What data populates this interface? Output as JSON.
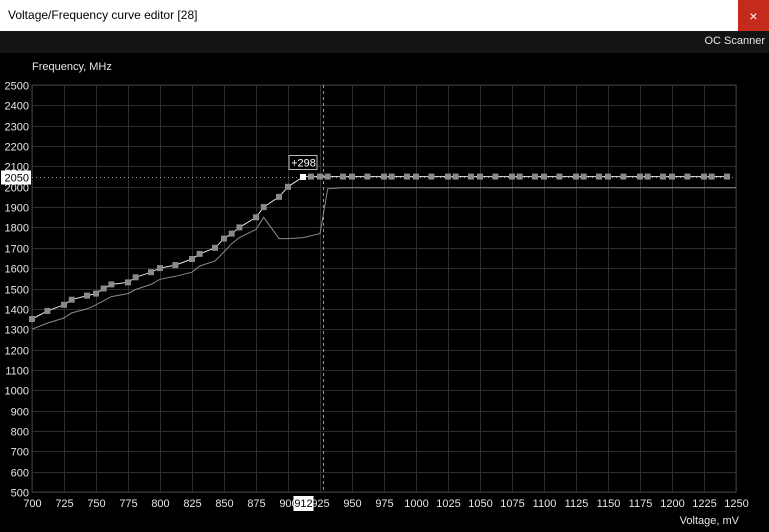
{
  "window": {
    "title": "Voltage/Frequency curve editor [28]",
    "close_label": "×"
  },
  "toolbar": {
    "oc_scanner_label": "OC Scanner"
  },
  "chart_data": {
    "type": "line",
    "ylabel": "Frequency, MHz",
    "xlabel": "Voltage, mV",
    "xlim": [
      700,
      1250
    ],
    "ylim": [
      500,
      2500
    ],
    "x_ticks": [
      700,
      725,
      750,
      775,
      800,
      825,
      850,
      875,
      900,
      925,
      950,
      975,
      1000,
      1025,
      1050,
      1075,
      1100,
      1125,
      1150,
      1175,
      1200,
      1225,
      1250
    ],
    "y_ticks": [
      500,
      600,
      700,
      800,
      900,
      1000,
      1100,
      1200,
      1300,
      1400,
      1500,
      1600,
      1700,
      1800,
      1900,
      2000,
      2100,
      2200,
      2300,
      2400,
      2500
    ],
    "grid": true,
    "selected_point": {
      "voltage": 912,
      "voltage_label": "912",
      "frequency": 2050,
      "frequency_label": "2050",
      "offset_label": "+298"
    },
    "series": [
      {
        "role": "edited-curve",
        "color": "#e6e6e6",
        "points": [
          [
            700,
            1350
          ],
          [
            712,
            1390
          ],
          [
            725,
            1420
          ],
          [
            731,
            1445
          ],
          [
            743,
            1465
          ],
          [
            750,
            1475
          ],
          [
            756,
            1500
          ],
          [
            762,
            1520
          ],
          [
            775,
            1530
          ],
          [
            781,
            1555
          ],
          [
            793,
            1580
          ],
          [
            800,
            1600
          ],
          [
            812,
            1615
          ],
          [
            825,
            1645
          ],
          [
            831,
            1670
          ],
          [
            843,
            1700
          ],
          [
            850,
            1745
          ],
          [
            856,
            1770
          ],
          [
            862,
            1800
          ],
          [
            875,
            1850
          ],
          [
            881,
            1900
          ],
          [
            893,
            1950
          ],
          [
            900,
            2000
          ],
          [
            912,
            2050
          ],
          [
            918,
            2050
          ],
          [
            925,
            2050
          ],
          [
            931,
            2050
          ],
          [
            943,
            2050
          ],
          [
            950,
            2050
          ],
          [
            962,
            2050
          ],
          [
            975,
            2050
          ],
          [
            981,
            2050
          ],
          [
            993,
            2050
          ],
          [
            1000,
            2050
          ],
          [
            1012,
            2050
          ],
          [
            1025,
            2050
          ],
          [
            1031,
            2050
          ],
          [
            1043,
            2050
          ],
          [
            1050,
            2050
          ],
          [
            1062,
            2050
          ],
          [
            1075,
            2050
          ],
          [
            1081,
            2050
          ],
          [
            1093,
            2050
          ],
          [
            1100,
            2050
          ],
          [
            1112,
            2050
          ],
          [
            1125,
            2050
          ],
          [
            1131,
            2050
          ],
          [
            1143,
            2050
          ],
          [
            1150,
            2050
          ],
          [
            1162,
            2050
          ],
          [
            1175,
            2050
          ],
          [
            1181,
            2050
          ],
          [
            1193,
            2050
          ],
          [
            1200,
            2050
          ],
          [
            1212,
            2050
          ],
          [
            1225,
            2050
          ],
          [
            1231,
            2050
          ],
          [
            1243,
            2050
          ]
        ]
      },
      {
        "role": "original-curve",
        "color": "#8a8a8a",
        "points": [
          [
            700,
            1300
          ],
          [
            712,
            1330
          ],
          [
            725,
            1355
          ],
          [
            731,
            1380
          ],
          [
            743,
            1400
          ],
          [
            750,
            1420
          ],
          [
            756,
            1440
          ],
          [
            762,
            1460
          ],
          [
            775,
            1475
          ],
          [
            781,
            1495
          ],
          [
            793,
            1520
          ],
          [
            800,
            1545
          ],
          [
            812,
            1560
          ],
          [
            825,
            1580
          ],
          [
            831,
            1610
          ],
          [
            843,
            1635
          ],
          [
            850,
            1680
          ],
          [
            856,
            1720
          ],
          [
            862,
            1750
          ],
          [
            875,
            1790
          ],
          [
            881,
            1850
          ],
          [
            893,
            1745
          ],
          [
            900,
            1745
          ],
          [
            912,
            1750
          ],
          [
            925,
            1770
          ],
          [
            931,
            1990
          ],
          [
            943,
            1995
          ],
          [
            1050,
            1995
          ],
          [
            1150,
            1995
          ],
          [
            1250,
            1995
          ]
        ]
      }
    ]
  }
}
